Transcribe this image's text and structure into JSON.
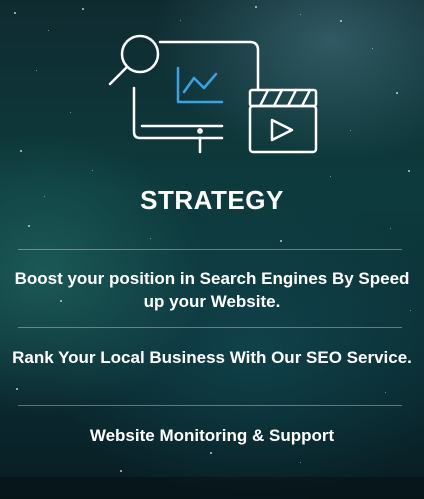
{
  "card": {
    "title": "STRATEGY",
    "icon": "seo-strategy-icon",
    "accent_color": "#3aa3e3",
    "services": [
      "Boost your position in Search Engines By Speed up your Website.",
      "Rank Your Local Business With Our SEO Service.",
      "Website Monitoring & Support"
    ]
  }
}
